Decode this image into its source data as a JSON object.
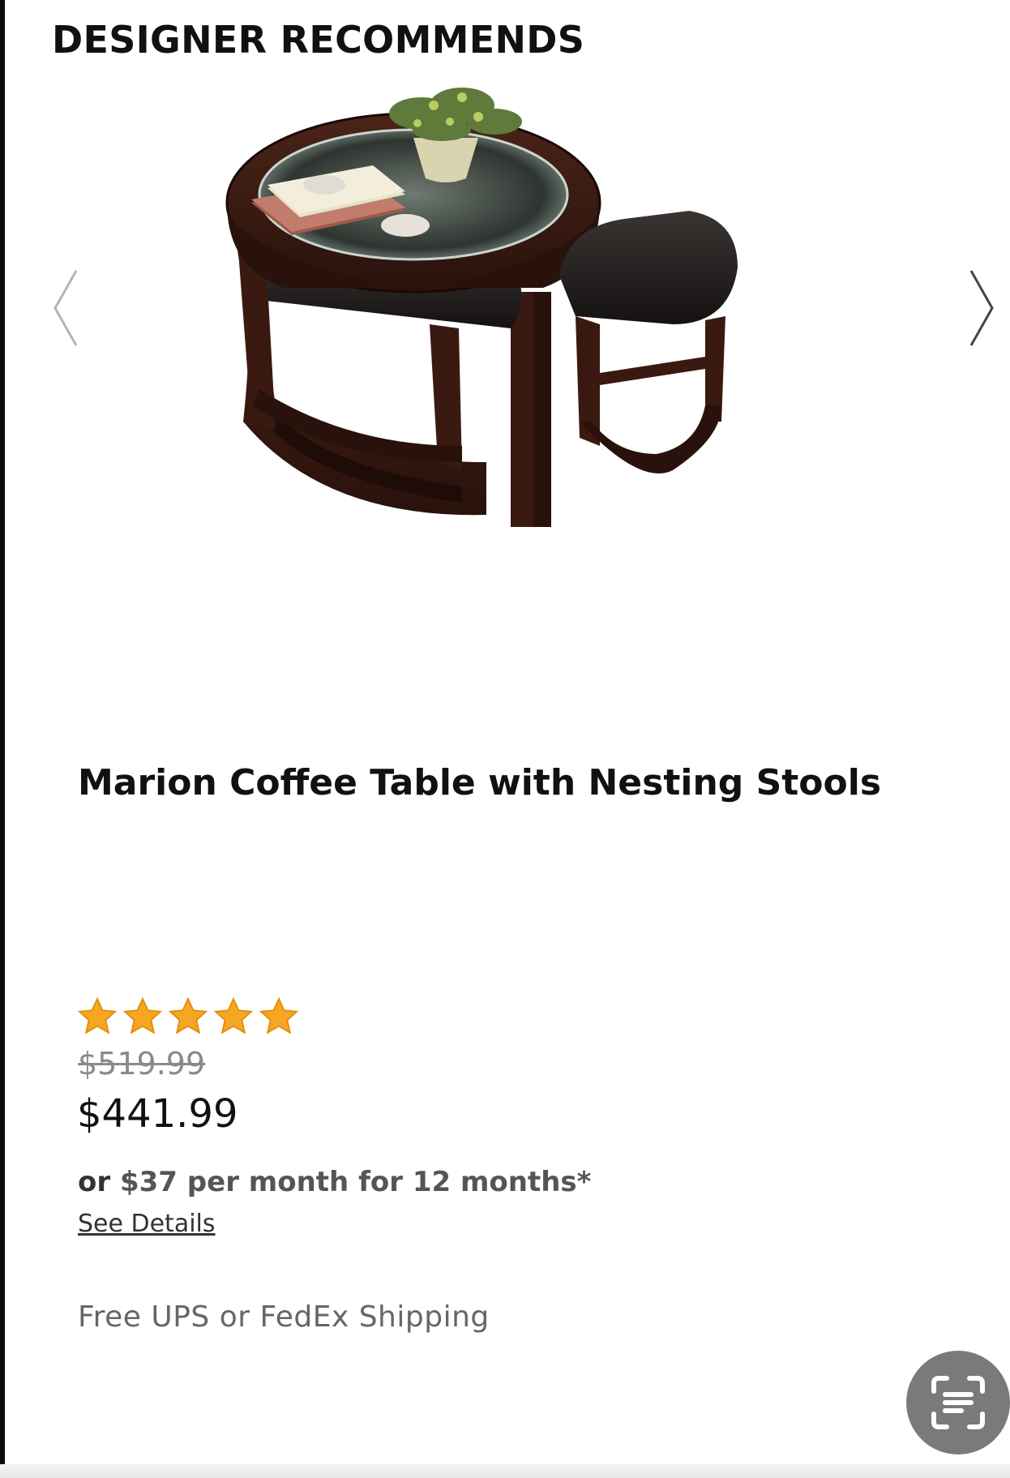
{
  "section": {
    "title": "DESIGNER RECOMMENDS"
  },
  "carousel": {
    "prev_icon": "chevron-left-icon",
    "next_icon": "chevron-right-icon"
  },
  "product": {
    "image_icon": "coffee-table-with-stools-image",
    "name": "Marion Coffee Table with Nesting Stools",
    "rating": 5,
    "rating_max": 5,
    "star_color": "#f5a623",
    "original_price": "$519.99",
    "sale_price": "$441.99",
    "financing": {
      "prefix": "or",
      "text": "$37 per month for 12 months*"
    },
    "see_details": "See Details",
    "shipping": "Free UPS or FedEx Shipping"
  },
  "floating_button": {
    "icon": "text-scan-icon",
    "color": "#7a7a7a"
  }
}
